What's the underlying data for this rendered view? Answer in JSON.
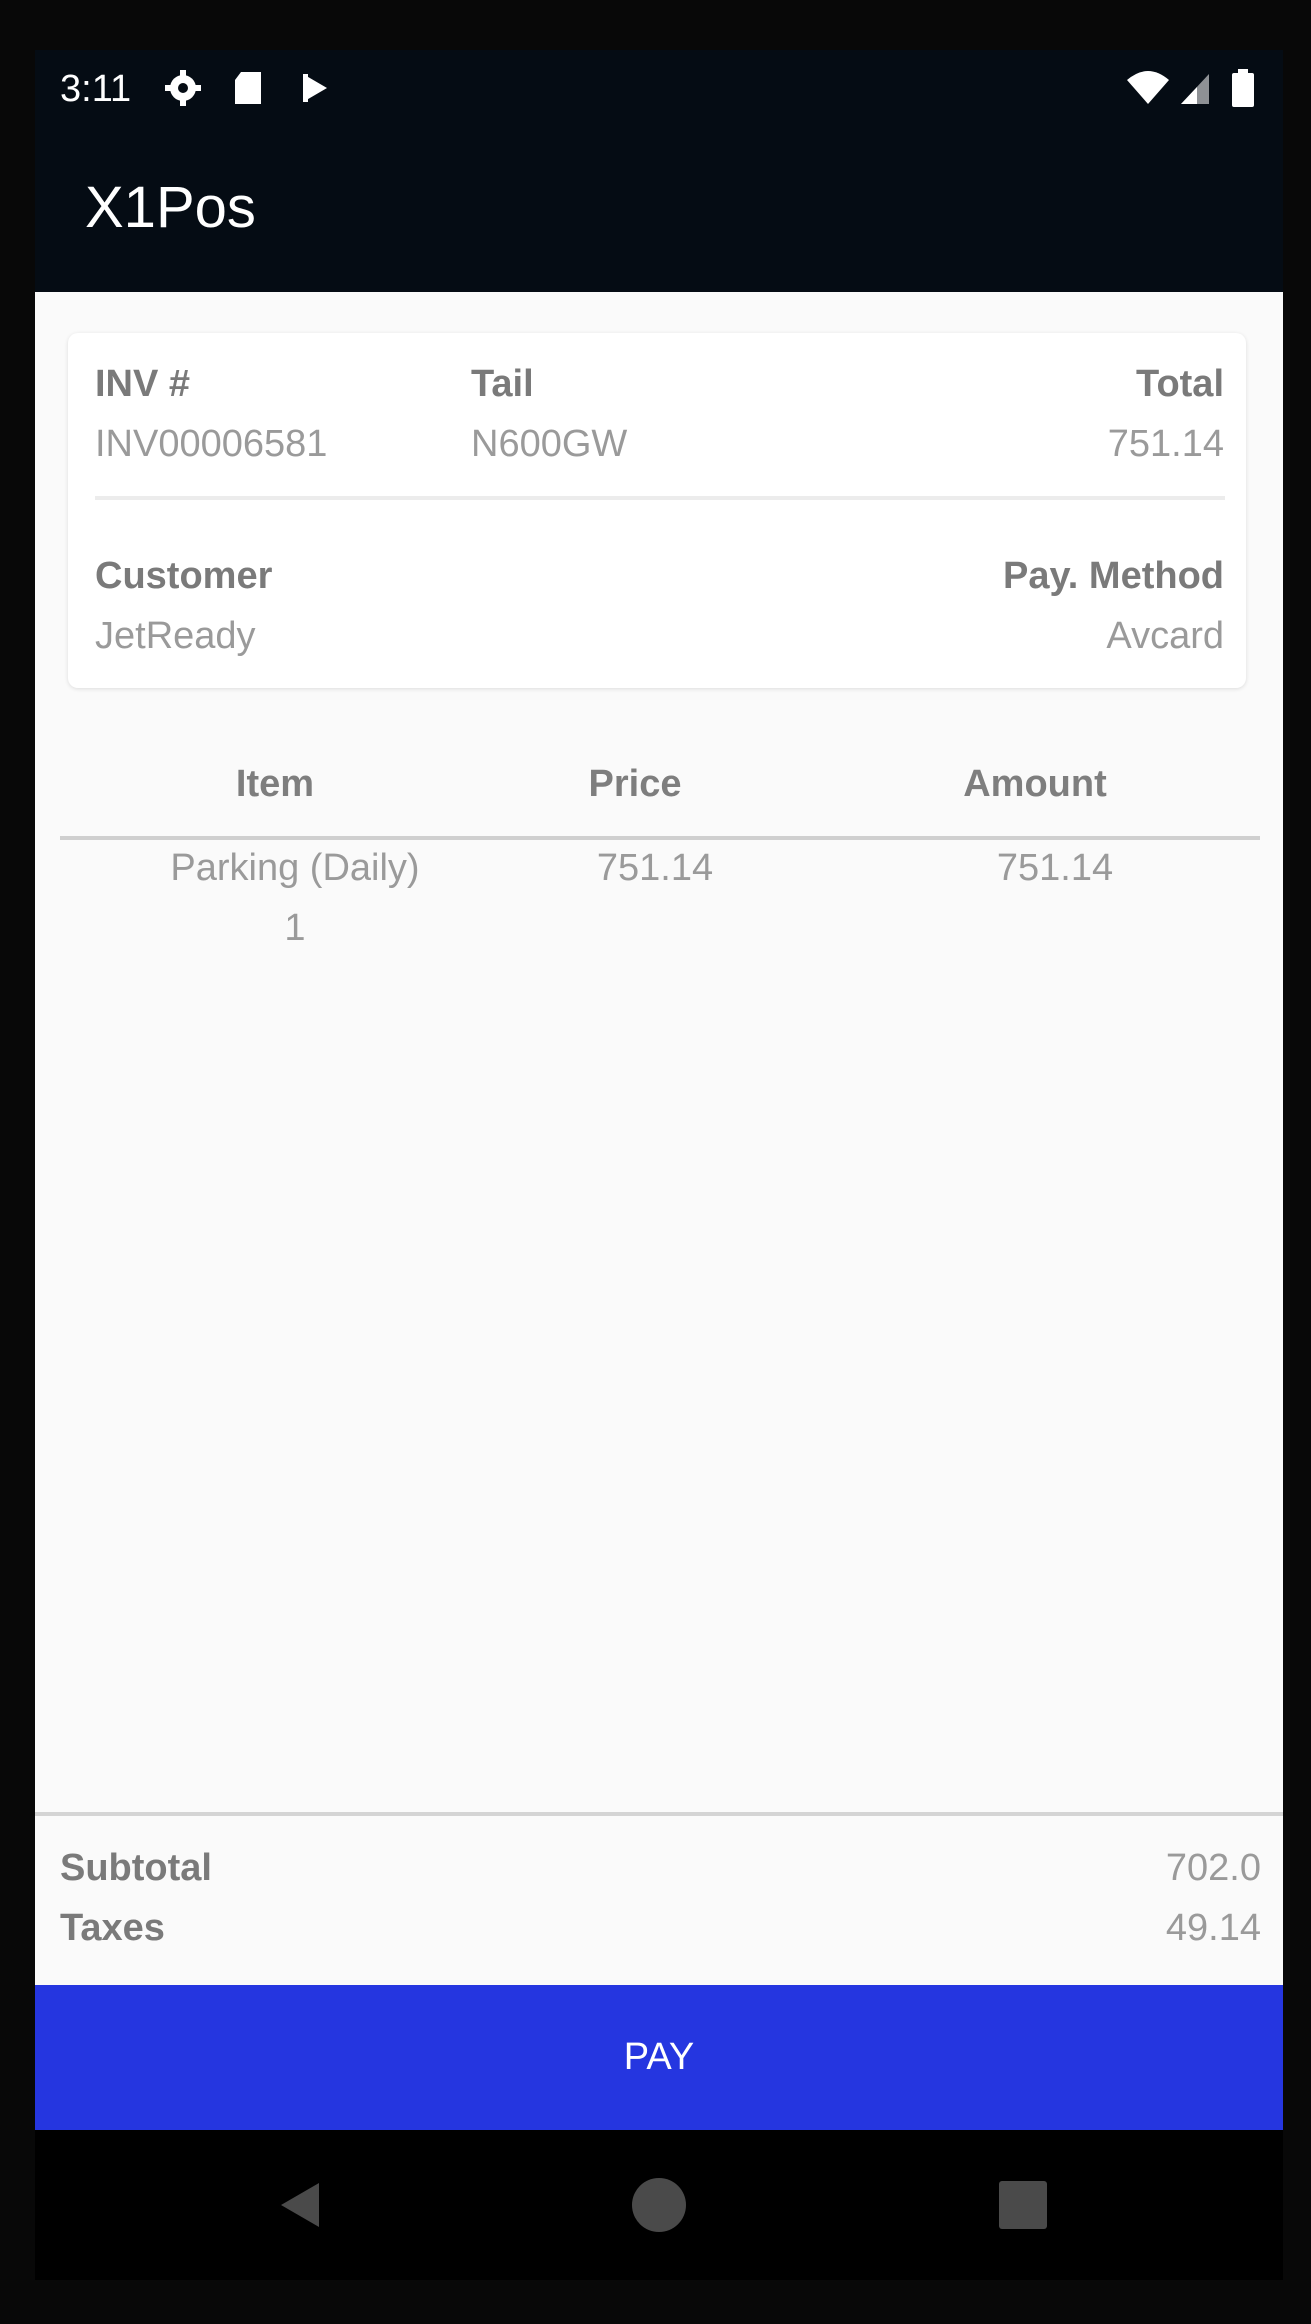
{
  "status_bar": {
    "time": "3:11",
    "left_icons": [
      "gear-icon",
      "sd-card-icon",
      "play-store-icon"
    ],
    "right_icons": [
      "wifi-icon",
      "cell-signal-icon",
      "battery-icon"
    ]
  },
  "app_bar": {
    "title": "X1Pos"
  },
  "invoice": {
    "inv_label": "INV #",
    "inv_value": "INV00006581",
    "tail_label": "Tail",
    "tail_value": "N600GW",
    "total_label": "Total",
    "total_value": "751.14",
    "customer_label": "Customer",
    "customer_value": "JetReady",
    "pay_method_label": "Pay. Method",
    "pay_method_value": "Avcard"
  },
  "table": {
    "headers": {
      "item": "Item",
      "price": "Price",
      "amount": "Amount"
    },
    "rows": [
      {
        "item": "Parking (Daily)",
        "qty": "1",
        "price": "751.14",
        "amount": "751.14"
      }
    ]
  },
  "totals": {
    "subtotal_label": "Subtotal",
    "subtotal_value": "702.0",
    "taxes_label": "Taxes",
    "taxes_value": "49.14"
  },
  "pay_button": {
    "label": "PAY"
  },
  "nav_bar": {
    "icons": [
      "back-icon",
      "home-icon",
      "recents-icon"
    ]
  },
  "colors": {
    "app_bar": "#050c14",
    "pay_button": "#2536e0",
    "background": "#fafafa"
  }
}
